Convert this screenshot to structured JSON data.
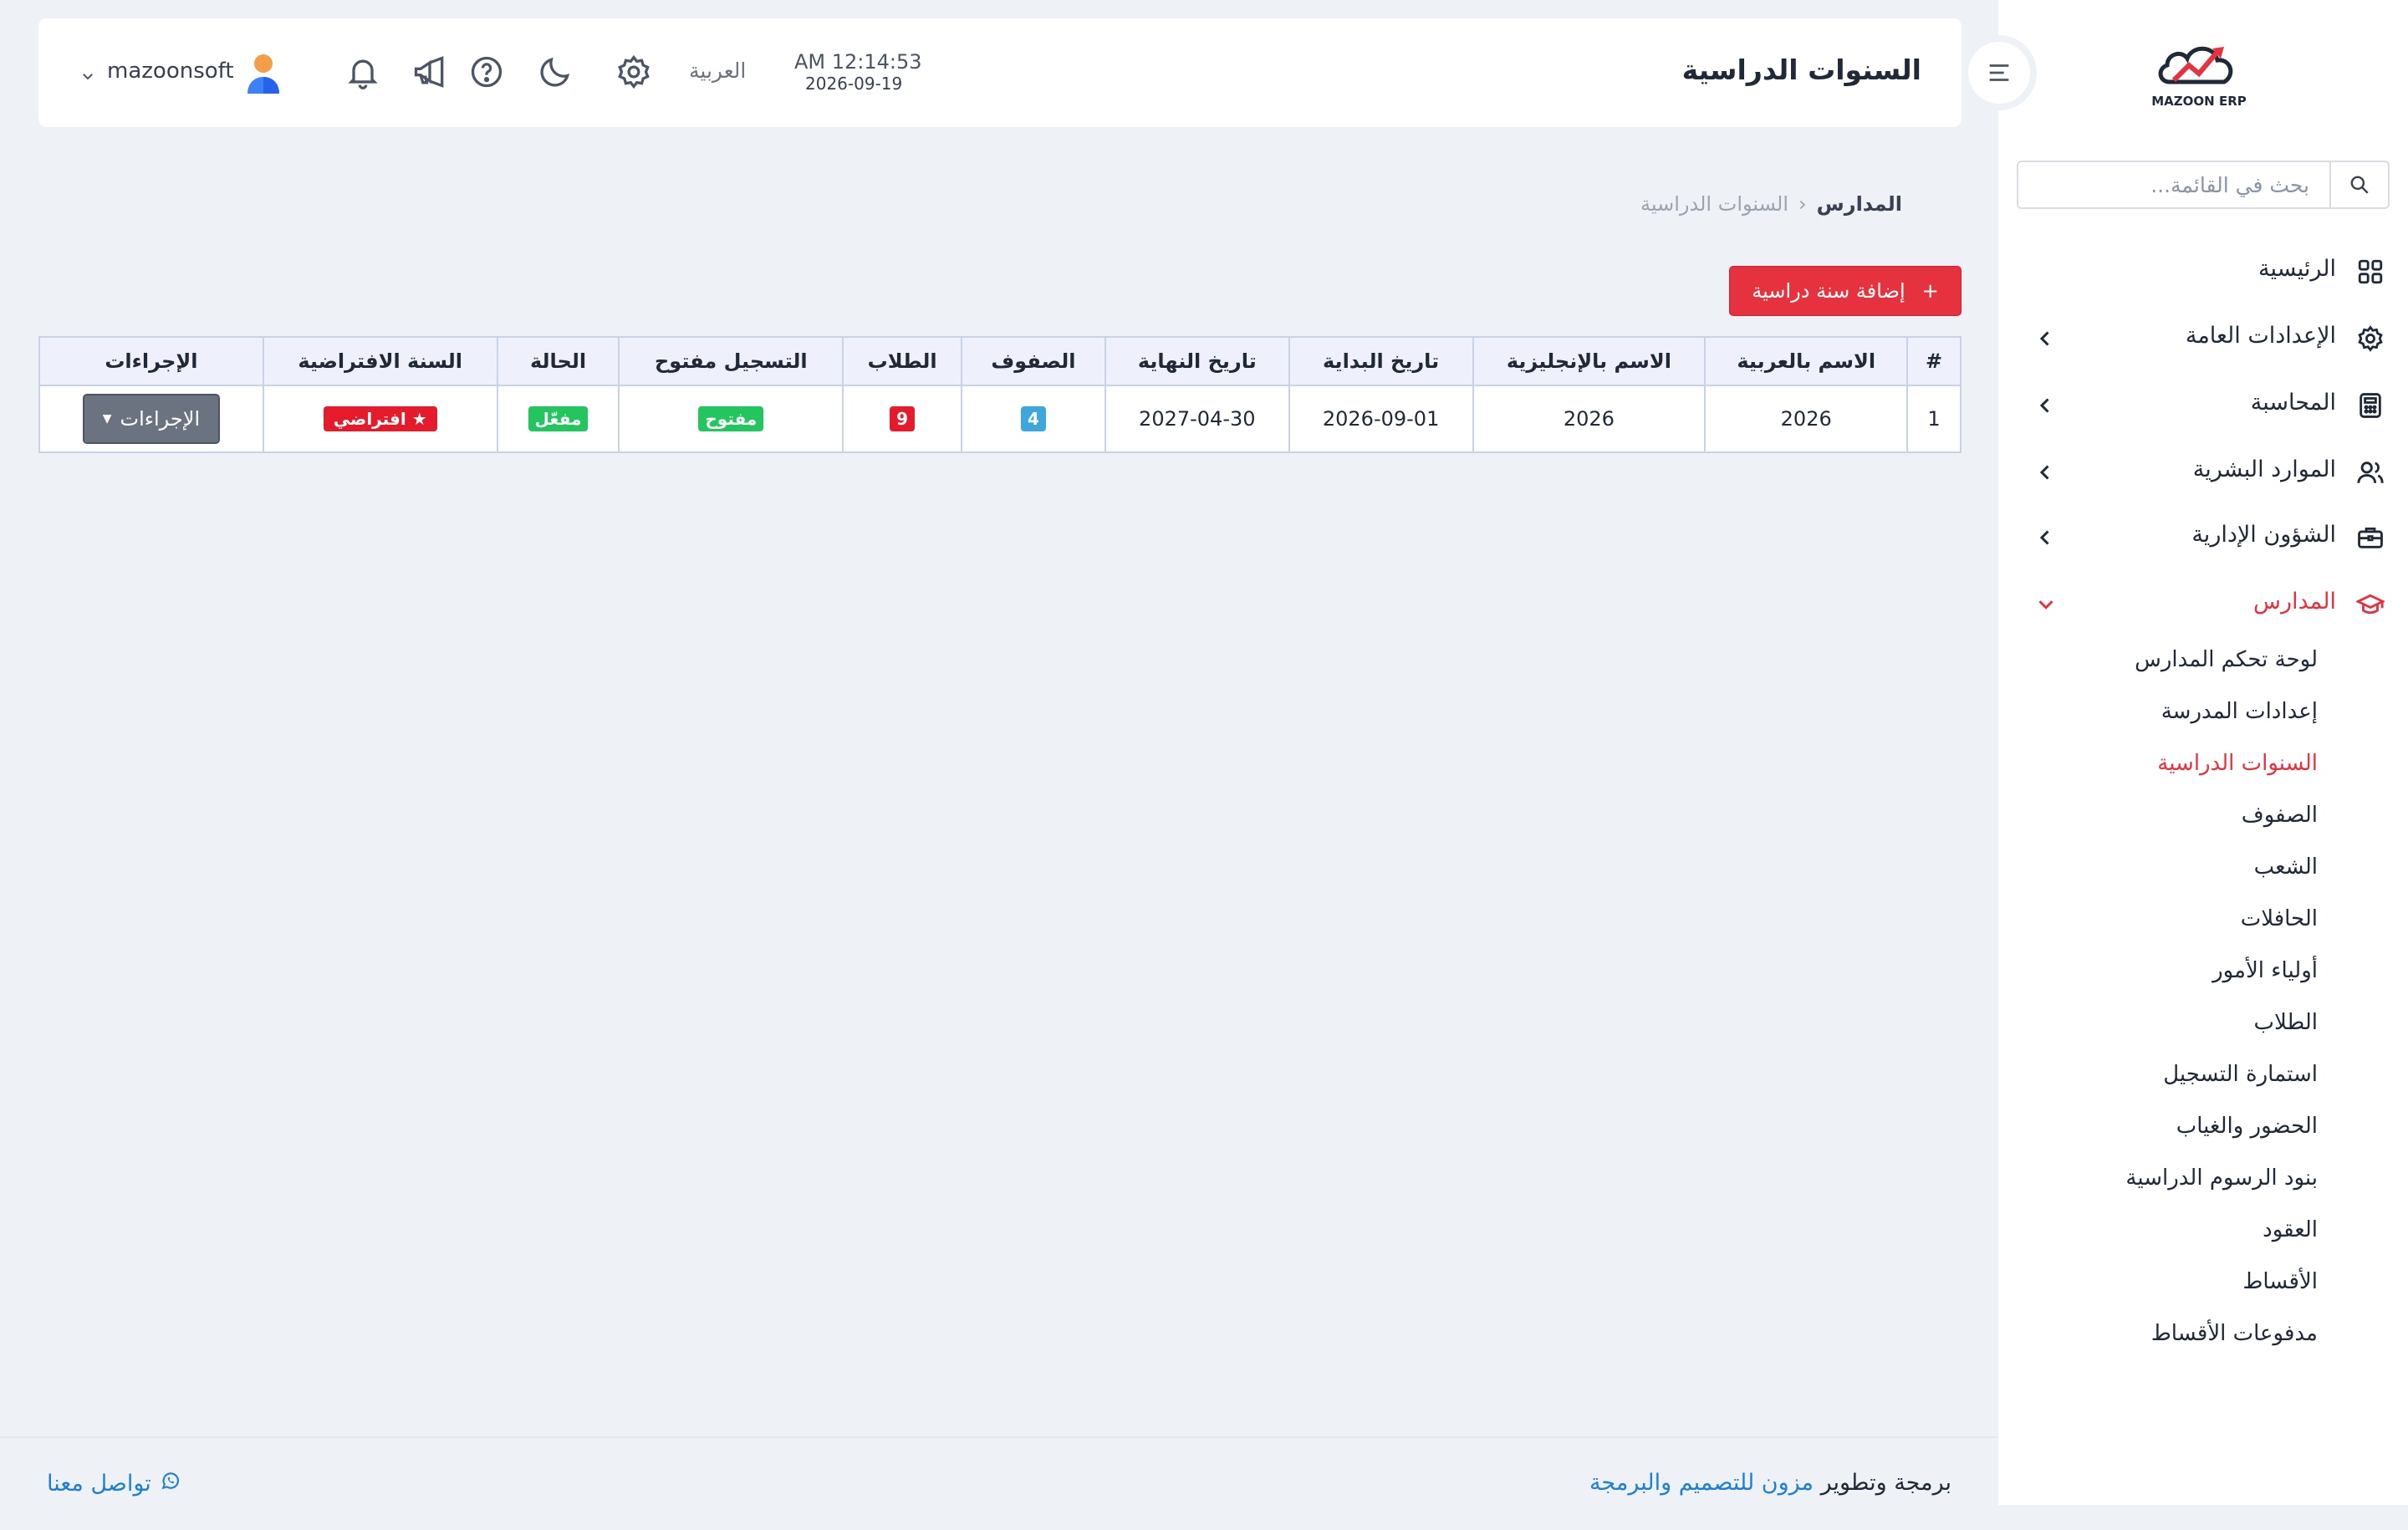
{
  "sidebar": {
    "logo_text": "MAZOON ERP",
    "search_placeholder": "بحث في القائمة...",
    "nav": [
      {
        "label": "الرئيسية",
        "icon": "grid-icon"
      },
      {
        "label": "الإعدادات العامة",
        "icon": "gear-icon"
      },
      {
        "label": "المحاسبة",
        "icon": "calculator-icon"
      },
      {
        "label": "الموارد البشرية",
        "icon": "users-icon"
      },
      {
        "label": "الشؤون الإدارية",
        "icon": "briefcase-icon"
      },
      {
        "label": "المدارس",
        "icon": "graduation-cap-icon"
      }
    ],
    "schools_sub": [
      "لوحة تحكم المدارس",
      "إعدادات المدرسة",
      "السنوات الدراسية",
      "الصفوف",
      "الشعب",
      "الحافلات",
      "أولياء الأمور",
      "الطلاب",
      "استمارة التسجيل",
      "الحضور والغياب",
      "بنود الرسوم الدراسية",
      "العقود",
      "الأقساط",
      "مدفوعات الأقساط"
    ],
    "active_color": "#e5323e"
  },
  "header": {
    "title": "السنوات الدراسية",
    "time": "AM 12:14:53",
    "date": "2026-09-19",
    "language": "العربية",
    "user": "mazoonsoft"
  },
  "breadcrumb": {
    "parent": "المدارس",
    "current": "السنوات الدراسية"
  },
  "add_button": {
    "label": "إضافة سنة دراسية",
    "icon": "plus-icon",
    "color": "#e5323e"
  },
  "table": {
    "headers": [
      "#",
      "الاسم بالعربية",
      "الاسم بالإنجليزية",
      "تاريخ البداية",
      "تاريخ النهاية",
      "الصفوف",
      "الطلاب",
      "التسجيل مفتوح",
      "الحالة",
      "السنة الافتراضية",
      "الإجراءات"
    ],
    "rows": [
      {
        "num": "1",
        "name_ar": "2026",
        "name_en": "2026",
        "start": "2026-09-01",
        "end": "2027-04-30",
        "classes": "4",
        "students": "9",
        "registration": "مفتوح",
        "status": "مفعّل",
        "default": "افتراضي",
        "actions": "الإجراءات"
      }
    ]
  },
  "footer": {
    "credit_prefix": "برمجة وتطوير ",
    "credit_link": "مزون للتصميم والبرمجة",
    "contact": "تواصل معنا"
  }
}
